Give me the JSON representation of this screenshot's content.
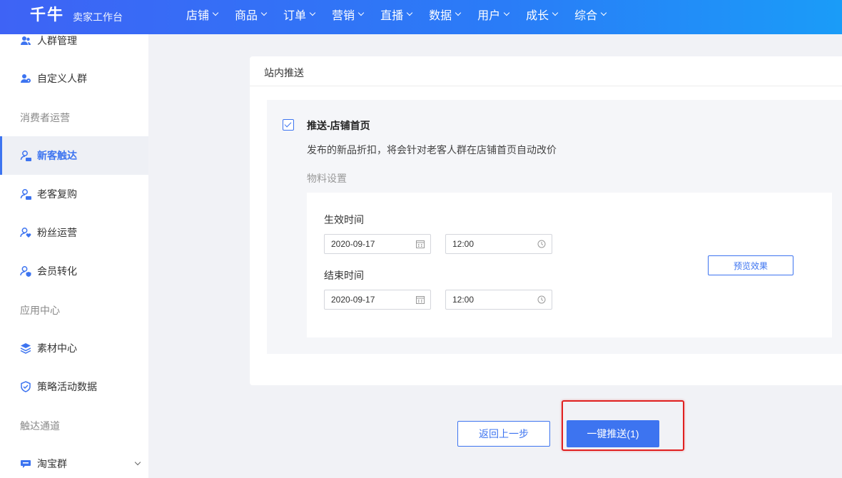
{
  "header": {
    "logo": "千牛",
    "logo_sub": "卖家工作台",
    "nav": [
      "店铺",
      "商品",
      "订单",
      "营销",
      "直播",
      "数据",
      "用户",
      "成长",
      "综合"
    ]
  },
  "sidebar": {
    "items": [
      {
        "label": "人群管理",
        "icon": "people-icon"
      },
      {
        "label": "自定义人群",
        "icon": "people-settings-icon"
      },
      {
        "label": "新客触达",
        "icon": "user-new-icon",
        "active": true
      },
      {
        "label": "老客复购",
        "icon": "user-old-icon"
      },
      {
        "label": "粉丝运营",
        "icon": "user-heart-icon"
      },
      {
        "label": "会员转化",
        "icon": "user-shield-icon"
      },
      {
        "label": "素材中心",
        "icon": "layers-icon"
      },
      {
        "label": "策略活动数据",
        "icon": "shield-icon"
      },
      {
        "label": "淘宝群",
        "icon": "chat-icon"
      }
    ],
    "sections": [
      "消费者运营",
      "应用中心",
      "触达通道"
    ]
  },
  "card": {
    "title": "站内推送",
    "push_title": "推送-店铺首页",
    "push_desc": "发布的新品折扣，将会针对老客人群在店铺首页自动改价",
    "material_label": "物料设置",
    "start_label": "生效时间",
    "start_date": "2020-09-17",
    "start_time": "12:00",
    "end_label": "结束时间",
    "end_date": "2020-09-17",
    "end_time": "12:00",
    "preview": "预览效果",
    "checked": true
  },
  "actions": {
    "back": "返回上一步",
    "push": "一键推送(1)"
  },
  "colors": {
    "accent": "#3d74f0",
    "highlight": "#e02020"
  }
}
